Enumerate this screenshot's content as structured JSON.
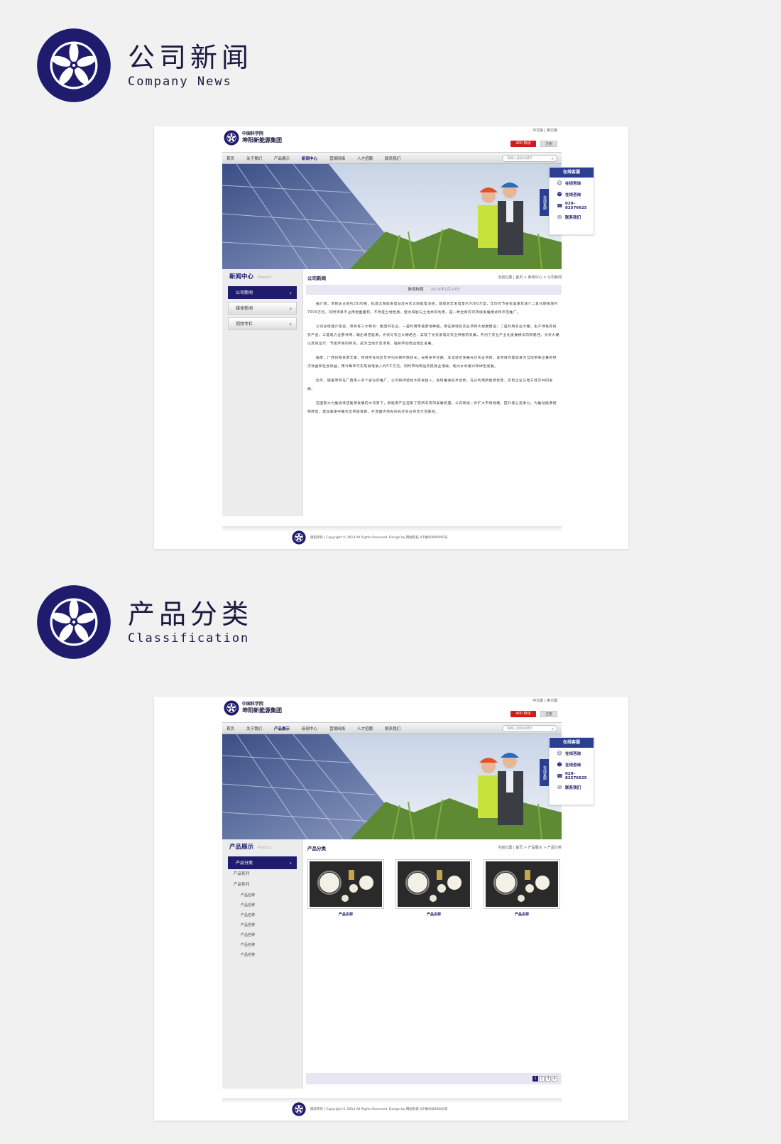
{
  "section_news": {
    "title_cn": "公司新闻",
    "title_en": "Company News"
  },
  "section_products": {
    "title_cn": "产品分类",
    "title_en": "Classification"
  },
  "site": {
    "brand_line1": "中国科学院",
    "brand_line2": "坤阳新能源集团",
    "lang": "中文版 | 英文版",
    "btn_red": "400 热线",
    "btn_grey": "注册",
    "search_placeholder": "请输入搜索关键字",
    "nav_items": [
      "首页",
      "关于我们",
      "产品展示",
      "新闻中心",
      "营销网络",
      "人才招聘",
      "联系我们"
    ],
    "float": {
      "title": "在线客服",
      "tab": "在线客服",
      "rows": [
        "在线咨询",
        "在线咨询",
        "020-82576625",
        "联系我们"
      ]
    },
    "footer": "版权所有 | Copyright © 2014 All Rights Reserved. Design by 网站科技  ICP备00000000号"
  },
  "news_page": {
    "side_title": "新闻中心",
    "side_title_en": "Product",
    "side_items": [
      "公司新闻",
      "媒体新闻",
      "视频专栏"
    ],
    "crumb_title": "公司新闻",
    "crumb_path": "当前位置 | 首页 > 新闻中心 > 公司新闻",
    "article_title": "新闻标题",
    "article_date": "2014年1月20日",
    "paragraphs": [
      "据介绍，项目总占地约2500亩，拟建太阳能发电站及光伏太阳能电池组，建成后年发电量约7000万度，年均可节省标准煤及减少二氧化碳排放约7000万元，同时项目不占用地面面积，不改变土地性质，使太阳能与土地共同利用，是一种全新的可持续发展模式和示范推广。",
      "公司总经理介绍说，项目有三大特点：集团内农业、一是利用荒坡废地种植，保证耕地及农业项目大规模建设；二是利用农业大棚，生产绿色有机农产品；三是电力全部并网，输出清洁能源，光伏与农业大棚结合，实现了光伏发电与农业种植的双赢，开创了农业产业化发展模式的新路径。光伏大棚以高效运行、节能环保的特点，成为当地示范项目，辐射带动周边地区发展。",
      "据悉，广西日照资源丰富，项目所在地区年平均日照时数较长，光照条件优越，非常适合发展光伏农业项目。该项目的建成将为当地带来显著的经济效益和社会效益，预计每年可实现发电收入约5千万元，同时带动周边农民就业增收，助力乡村振兴和绿色发展。",
      "此外，随着项目在广西等十多个省份的推广，公司将持续加大研发投入，加快推进技术创新，充分利用新能源优势，实现企业与地方经济共同发展。",
      "在国家大力推进清洁能源发展的大背景下，新能源产业迎来了前所未有的发展机遇。公司将进一步扩大市场规模，提升核心竞争力，为推动能源结构转型、建设美丽中国作出积极贡献，打造国内领先的光伏农业综合示范基地。"
    ]
  },
  "product_page": {
    "side_title": "产品展示",
    "side_title_en": "Product",
    "side_active": "产品分类",
    "side_subs": [
      "产品系列",
      "产品系列"
    ],
    "side_leaves": [
      "产品名称",
      "产品名称",
      "产品名称",
      "产品名称",
      "产品名称",
      "产品名称",
      "产品名称"
    ],
    "crumb_title": "产品分类",
    "crumb_path": "当前位置 | 首页 > 产品展示 > 产品分类",
    "products": [
      "产品名称",
      "产品名称",
      "产品名称"
    ],
    "pages": [
      "1",
      "2",
      "3",
      "4"
    ]
  },
  "colors": {
    "brand_navy": "#1f1c6e",
    "accent_blue": "#2b3f92",
    "hotline_red": "#cc1e1e"
  }
}
